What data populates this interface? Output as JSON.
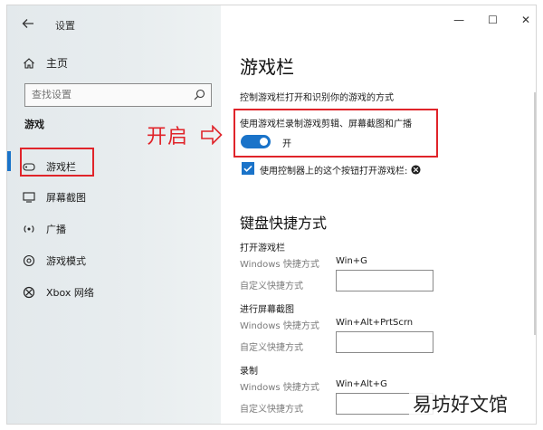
{
  "window": {
    "title": "设置",
    "controls": {
      "minimize": "—",
      "maximize": "☐",
      "close": "✕"
    }
  },
  "sidebar": {
    "home_label": "主页",
    "search_placeholder": "查找设置",
    "section_label": "游戏",
    "items": [
      {
        "label": "游戏栏",
        "icon": "game-bar-icon",
        "active": true
      },
      {
        "label": "屏幕截图",
        "icon": "capture-icon",
        "active": false
      },
      {
        "label": "广播",
        "icon": "broadcast-icon",
        "active": false
      },
      {
        "label": "游戏模式",
        "icon": "game-mode-icon",
        "active": false
      },
      {
        "label": "Xbox 网络",
        "icon": "xbox-icon",
        "active": false
      }
    ]
  },
  "main": {
    "title": "游戏栏",
    "description": "控制游戏栏打开和识别你的游戏的方式",
    "record_setting": {
      "label": "使用游戏栏录制游戏剪辑、屏幕截图和广播",
      "state_label": "开",
      "on": true
    },
    "controller_setting": {
      "label": "使用控制器上的这个按钮打开游戏栏:",
      "checked": true
    },
    "shortcuts_title": "键盘快捷方式",
    "groups": [
      {
        "title": "打开游戏栏",
        "windows_label": "Windows 快捷方式",
        "windows_value": "Win+G",
        "custom_label": "自定义快捷方式",
        "custom_value": ""
      },
      {
        "title": "进行屏幕截图",
        "windows_label": "Windows 快捷方式",
        "windows_value": "Win+Alt+PrtScrn",
        "custom_label": "自定义快捷方式",
        "custom_value": ""
      },
      {
        "title": "录制",
        "windows_label": "Windows 快捷方式",
        "windows_value": "Win+Alt+G",
        "custom_label": "自定义快捷方式",
        "custom_value": ""
      }
    ]
  },
  "annotation": {
    "text": "开启",
    "color": "#e0242a"
  },
  "watermark": "易坊好文馆",
  "colors": {
    "accent": "#1a73c9",
    "highlight": "#e0242a"
  }
}
